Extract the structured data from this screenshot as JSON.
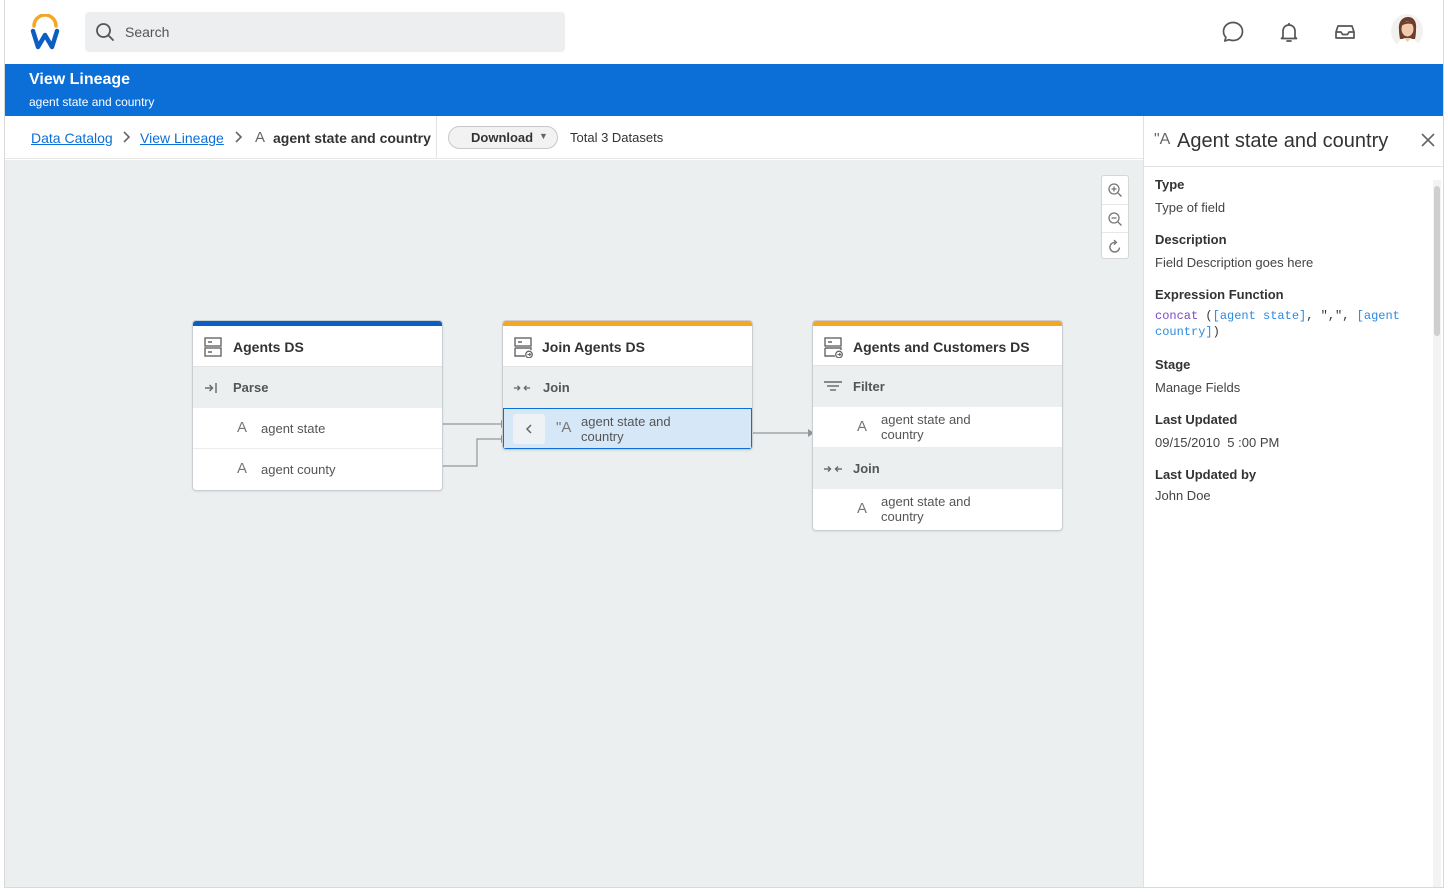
{
  "search": {
    "placeholder": "Search"
  },
  "page": {
    "title": "View Lineage",
    "subtitle": "agent state and country"
  },
  "breadcrumb": {
    "items": [
      {
        "label": "Data Catalog"
      },
      {
        "label": "View Lineage"
      }
    ],
    "current": "agent state and country",
    "current_icon": "A"
  },
  "toolbar": {
    "download_label": "Download",
    "download_caret": "▼",
    "total": "Total 3 Datasets"
  },
  "colors": {
    "brand_blue": "#0b6fd7",
    "source_bar": "#0b5fc2",
    "transform_bar": "#f5a623",
    "selected_bg": "#d6e8f8"
  },
  "cards": [
    {
      "title": "Agents DS",
      "icon": "dataset-icon",
      "steps": [
        {
          "label": "Parse",
          "icon": "parse-icon",
          "fields": [
            {
              "icon": "A",
              "label": "agent state"
            },
            {
              "icon": "A",
              "label": "agent county"
            }
          ]
        }
      ]
    },
    {
      "title": "Join Agents DS",
      "icon": "derived-dataset-icon",
      "steps": [
        {
          "label": "Join",
          "icon": "join-icon",
          "fields": [
            {
              "icon": "\"A",
              "label": "agent state and country",
              "selected": true
            }
          ]
        }
      ]
    },
    {
      "title": "Agents and Customers DS",
      "icon": "derived-dataset-icon",
      "steps": [
        {
          "label": "Filter",
          "icon": "filter-icon",
          "fields": [
            {
              "icon": "A",
              "label": "agent state and country"
            }
          ]
        },
        {
          "label": "Join",
          "icon": "join-icon",
          "fields": [
            {
              "icon": "A",
              "label": "agent state and country"
            }
          ]
        }
      ]
    }
  ],
  "panel": {
    "icon": "\"A",
    "title": "Agent state and country",
    "props": {
      "type_label": "Type",
      "type_value": "Type of field",
      "desc_label": "Description",
      "desc_value": "Field Description goes here",
      "expr_label": "Expression Function",
      "expr_fn": "concat",
      "expr_open": " (",
      "expr_arg1": "[agent state]",
      "expr_sep": ", \",\", ",
      "expr_arg2": "[agent country]",
      "expr_close": ")",
      "stage_label": "Stage",
      "stage_value": "Manage Fields",
      "updated_label": "Last Updated",
      "updated_value": "09/15/2010  5 :00 PM",
      "updated_by_label": "Last Updated by",
      "updated_by_value": "John Doe"
    }
  }
}
